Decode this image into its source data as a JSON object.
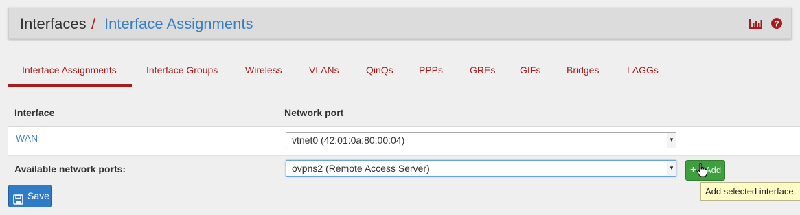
{
  "header": {
    "root": "Interfaces",
    "separator": "/",
    "current": "Interface Assignments",
    "icons": [
      "bar-chart-icon",
      "help-icon"
    ],
    "accent_color": "#a61c1c",
    "link_color": "#3a7fc1"
  },
  "tabs": [
    {
      "label": "Interface Assignments",
      "active": true
    },
    {
      "label": "Interface Groups",
      "active": false
    },
    {
      "label": "Wireless",
      "active": false
    },
    {
      "label": "VLANs",
      "active": false
    },
    {
      "label": "QinQs",
      "active": false
    },
    {
      "label": "PPPs",
      "active": false
    },
    {
      "label": "GREs",
      "active": false
    },
    {
      "label": "GIFs",
      "active": false
    },
    {
      "label": "Bridges",
      "active": false
    },
    {
      "label": "LAGGs",
      "active": false
    }
  ],
  "table": {
    "headers": {
      "interface": "Interface",
      "network_port": "Network port"
    },
    "rows": [
      {
        "interface": "WAN",
        "port": "vtnet0 (42:01:0a:80:00:04)"
      }
    ],
    "available": {
      "label": "Available network ports:",
      "selected": "ovpns2 (Remote Access Server)"
    }
  },
  "add_button": {
    "label": "Add",
    "icon": "plus-icon",
    "color": "#3e9f3e"
  },
  "tooltip": "Add selected interface",
  "save_button": {
    "label": "Save",
    "icon": "save-icon",
    "color": "#2f7bc7"
  }
}
